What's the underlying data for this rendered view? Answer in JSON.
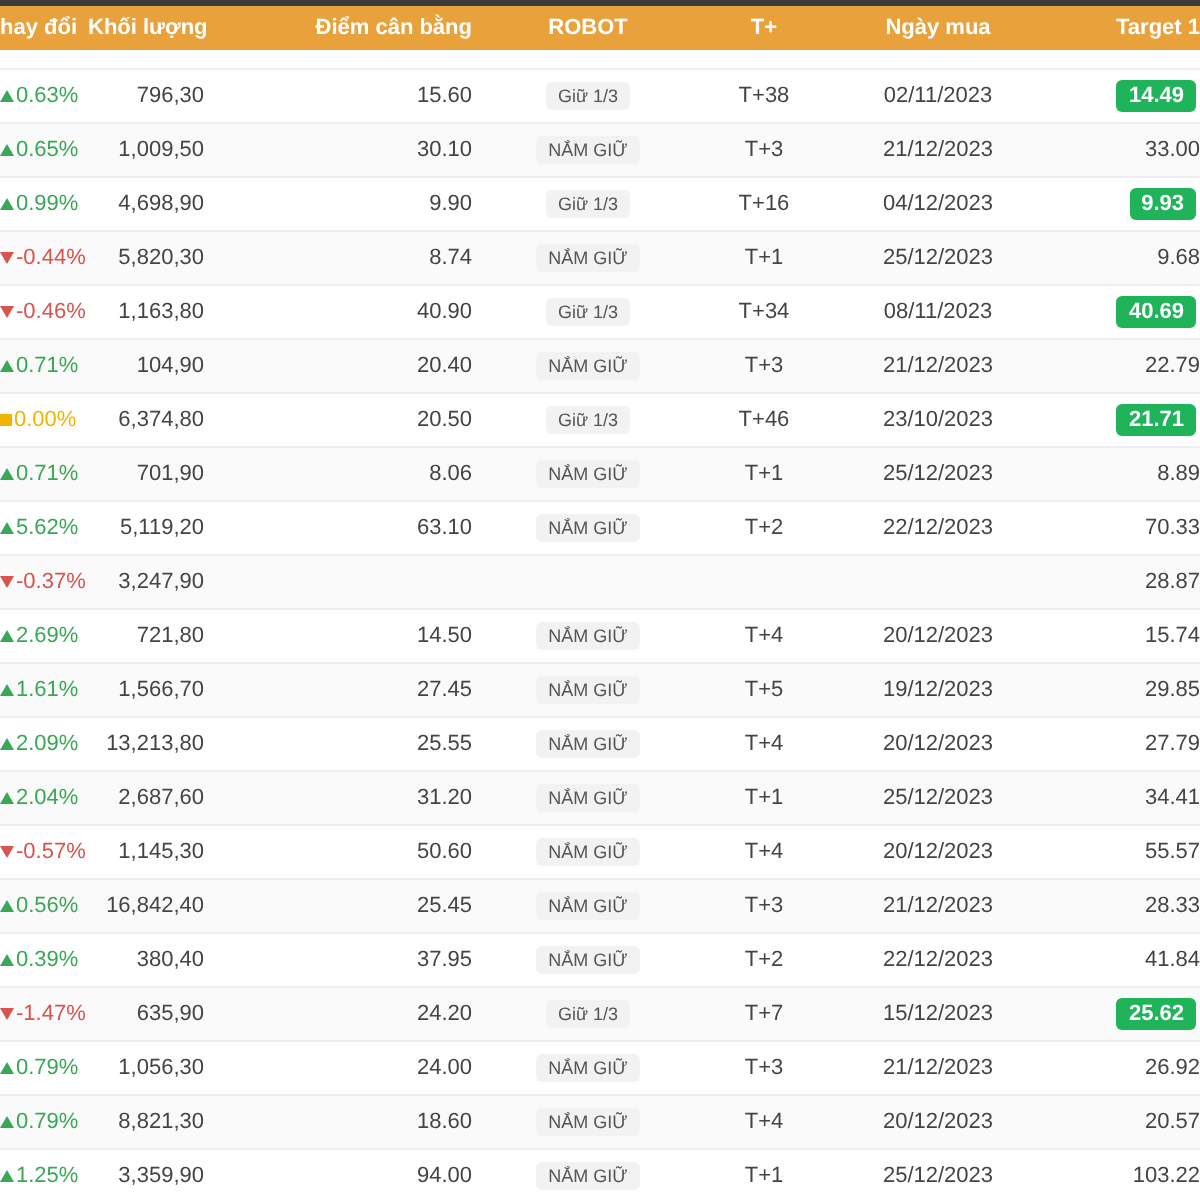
{
  "table": {
    "columns": [
      "hay đổi",
      "Khối lượng",
      "Điểm cân bằng",
      "ROBOT",
      "T+",
      "Ngày mua",
      "Target 1"
    ],
    "rows": [
      {
        "kind": "up",
        "change": "0.63%",
        "volume": "796,30",
        "balance": "15.60",
        "robot": "Giữ 1/3",
        "t": "T+38",
        "date": "02/11/2023",
        "target": "14.49",
        "target_hit": true
      },
      {
        "kind": "up",
        "change": "0.65%",
        "volume": "1,009,50",
        "balance": "30.10",
        "robot": "NẮM GIỮ",
        "t": "T+3",
        "date": "21/12/2023",
        "target": "33.00",
        "target_hit": false
      },
      {
        "kind": "up",
        "change": "0.99%",
        "volume": "4,698,90",
        "balance": "9.90",
        "robot": "Giữ 1/3",
        "t": "T+16",
        "date": "04/12/2023",
        "target": "9.93",
        "target_hit": true
      },
      {
        "kind": "down",
        "change": "-0.44%",
        "volume": "5,820,30",
        "balance": "8.74",
        "robot": "NẮM GIỮ",
        "t": "T+1",
        "date": "25/12/2023",
        "target": "9.68",
        "target_hit": false
      },
      {
        "kind": "down",
        "change": "-0.46%",
        "volume": "1,163,80",
        "balance": "40.90",
        "robot": "Giữ 1/3",
        "t": "T+34",
        "date": "08/11/2023",
        "target": "40.69",
        "target_hit": true
      },
      {
        "kind": "up",
        "change": "0.71%",
        "volume": "104,90",
        "balance": "20.40",
        "robot": "NẮM GIỮ",
        "t": "T+3",
        "date": "21/12/2023",
        "target": "22.79",
        "target_hit": false
      },
      {
        "kind": "flat",
        "change": "0.00%",
        "volume": "6,374,80",
        "balance": "20.50",
        "robot": "Giữ 1/3",
        "t": "T+46",
        "date": "23/10/2023",
        "target": "21.71",
        "target_hit": true
      },
      {
        "kind": "up",
        "change": "0.71%",
        "volume": "701,90",
        "balance": "8.06",
        "robot": "NẮM GIỮ",
        "t": "T+1",
        "date": "25/12/2023",
        "target": "8.89",
        "target_hit": false
      },
      {
        "kind": "up",
        "change": "5.62%",
        "volume": "5,119,20",
        "balance": "63.10",
        "robot": "NẮM GIỮ",
        "t": "T+2",
        "date": "22/12/2023",
        "target": "70.33",
        "target_hit": false
      },
      {
        "kind": "down",
        "change": "-0.37%",
        "volume": "3,247,90",
        "target": "28.87",
        "target_hit": false
      },
      {
        "kind": "up",
        "change": "2.69%",
        "volume": "721,80",
        "balance": "14.50",
        "robot": "NẮM GIỮ",
        "t": "T+4",
        "date": "20/12/2023",
        "target": "15.74",
        "target_hit": false
      },
      {
        "kind": "up",
        "change": "1.61%",
        "volume": "1,566,70",
        "balance": "27.45",
        "robot": "NẮM GIỮ",
        "t": "T+5",
        "date": "19/12/2023",
        "target": "29.85",
        "target_hit": false
      },
      {
        "kind": "up",
        "change": "2.09%",
        "volume": "13,213,80",
        "balance": "25.55",
        "robot": "NẮM GIỮ",
        "t": "T+4",
        "date": "20/12/2023",
        "target": "27.79",
        "target_hit": false
      },
      {
        "kind": "up",
        "change": "2.04%",
        "volume": "2,687,60",
        "balance": "31.20",
        "robot": "NẮM GIỮ",
        "t": "T+1",
        "date": "25/12/2023",
        "target": "34.41",
        "target_hit": false
      },
      {
        "kind": "down",
        "change": "-0.57%",
        "volume": "1,145,30",
        "balance": "50.60",
        "robot": "NẮM GIỮ",
        "t": "T+4",
        "date": "20/12/2023",
        "target": "55.57",
        "target_hit": false
      },
      {
        "kind": "up",
        "change": "0.56%",
        "volume": "16,842,40",
        "balance": "25.45",
        "robot": "NẮM GIỮ",
        "t": "T+3",
        "date": "21/12/2023",
        "target": "28.33",
        "target_hit": false
      },
      {
        "kind": "up",
        "change": "0.39%",
        "volume": "380,40",
        "balance": "37.95",
        "robot": "NẮM GIỮ",
        "t": "T+2",
        "date": "22/12/2023",
        "target": "41.84",
        "target_hit": false
      },
      {
        "kind": "down",
        "change": "-1.47%",
        "volume": "635,90",
        "balance": "24.20",
        "robot": "Giữ 1/3",
        "t": "T+7",
        "date": "15/12/2023",
        "target": "25.62",
        "target_hit": true
      },
      {
        "kind": "up",
        "change": "0.79%",
        "volume": "1,056,30",
        "balance": "24.00",
        "robot": "NẮM GIỮ",
        "t": "T+3",
        "date": "21/12/2023",
        "target": "26.92",
        "target_hit": false
      },
      {
        "kind": "up",
        "change": "0.79%",
        "volume": "8,821,30",
        "balance": "18.60",
        "robot": "NẮM GIỮ",
        "t": "T+4",
        "date": "20/12/2023",
        "target": "20.57",
        "target_hit": false
      },
      {
        "kind": "up",
        "change": "1.25%",
        "volume": "3,359,90",
        "balance": "94.00",
        "robot": "NẮM GIỮ",
        "t": "T+1",
        "date": "25/12/2023",
        "target": "103.22",
        "target_hit": false
      }
    ]
  }
}
